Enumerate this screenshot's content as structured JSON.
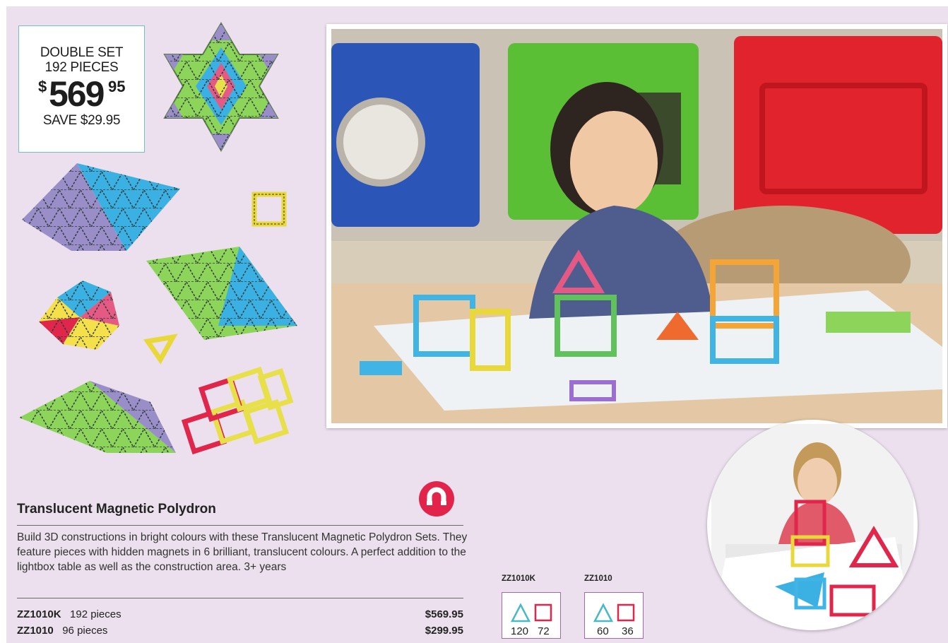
{
  "promo": {
    "line1": "DOUBLE SET",
    "line2": "192 PIECES",
    "dollar": "$",
    "price_main": "569",
    "price_cents": "95",
    "save": "SAVE $29.95"
  },
  "product": {
    "title": "Translucent Magnetic Polydron",
    "description": "Build 3D constructions in bright colours with these Translucent Magnetic Polydron Sets. They feature pieces with hidden magnets in 6 brilliant, translucent colours. A perfect addition to the lightbox table as well as the construction area. 3+ years",
    "items": [
      {
        "code": "ZZ1010K",
        "desc": "192 pieces",
        "price": "$569.95"
      },
      {
        "code": "ZZ1010",
        "desc": "96 pieces",
        "price": "$299.95"
      }
    ]
  },
  "kits": [
    {
      "code": "ZZ1010K",
      "triangles": "120",
      "squares": "72"
    },
    {
      "code": "ZZ1010",
      "triangles": "60",
      "squares": "36"
    }
  ],
  "colors": {
    "background": "#ece0ee",
    "promo_border": "#73bfc3",
    "magnet_badge": "#e3244a",
    "kit_border": "#a06aa8",
    "triangle_icon": "#48b9c7",
    "square_icon": "#e0264a"
  },
  "icons": {
    "magnet": "magnet-icon",
    "triangle": "triangle-icon",
    "square": "square-icon"
  }
}
